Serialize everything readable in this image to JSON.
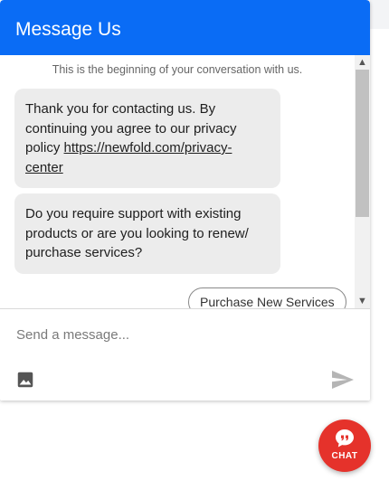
{
  "header": {
    "title": "Message Us"
  },
  "transcript": {
    "system_note": "This is the beginning of your conversation with us.",
    "messages": [
      {
        "text_before_link": "Thank you for contacting us. By continuing you agree to our privacy policy ",
        "link_text": "https://newfold.com/privacy-center"
      },
      {
        "text": "Do you require support with existing products or are you looking to renew/ purchase services?"
      }
    ],
    "quick_replies": [
      "Purchase New Services"
    ]
  },
  "composer": {
    "placeholder": "Send a message...",
    "attach_icon": "image-icon",
    "send_icon": "send-icon"
  },
  "launcher": {
    "label": "CHAT",
    "icon": "chat-bubble-icon"
  },
  "colors": {
    "header_bg": "#0a6cf5",
    "bubble_bg": "#ececec",
    "launcher_bg": "#e5322b"
  }
}
